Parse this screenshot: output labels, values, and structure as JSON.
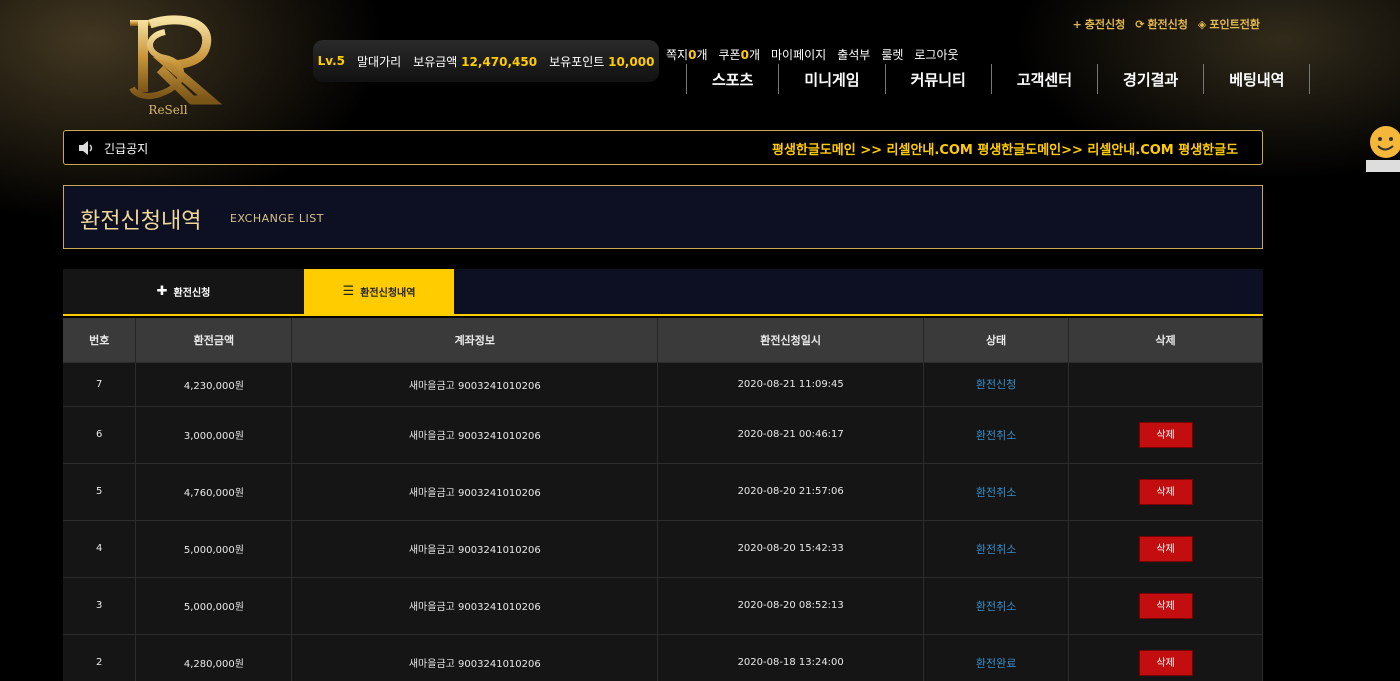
{
  "logo": {
    "text": "ReSell",
    "brand_color": "#d9b870"
  },
  "userbar": {
    "level": "Lv.5",
    "nickname": "말대가리",
    "balance_label": "보유금액",
    "balance_value": "12,470,450",
    "points_label": "보유포인트",
    "points_value": "10,000"
  },
  "toplinks": {
    "note_label": "쪽지",
    "note_count": "0",
    "note_unit": "개",
    "coupon_label": "쿠폰",
    "coupon_count": "0",
    "coupon_unit": "개",
    "mypage": "마이페이지",
    "attendance": "출석부",
    "roulette": "룰렛",
    "logout": "로그아웃"
  },
  "util": {
    "charge": "충전신청",
    "exchange": "환전신청",
    "points": "포인트전환"
  },
  "nav": [
    "스포츠",
    "미니게임",
    "커뮤니티",
    "고객센터",
    "경기결과",
    "베팅내역"
  ],
  "notice": {
    "label": "긴급공지",
    "marquee": "평생한글도메인 >> 리셀안내.COM 평생한글도메인>> 리셀안내.COM 평생한글도"
  },
  "page": {
    "title": "환전신청내역",
    "subtitle": "EXCHANGE LIST"
  },
  "tabs": {
    "request": "환전신청",
    "history": "환전신청내역"
  },
  "table": {
    "headers": [
      "번호",
      "환전금액",
      "계좌정보",
      "환전신청일시",
      "상태",
      "삭제"
    ],
    "delete_label": "삭제",
    "rows": [
      {
        "no": "7",
        "amount": "4,230,000원",
        "account": "새마을금고 9003241010206",
        "date": "2020-08-21 11:09:45",
        "status": "환전신청",
        "deletable": false
      },
      {
        "no": "6",
        "amount": "3,000,000원",
        "account": "새마을금고 9003241010206",
        "date": "2020-08-21 00:46:17",
        "status": "환전취소",
        "deletable": true
      },
      {
        "no": "5",
        "amount": "4,760,000원",
        "account": "새마을금고 9003241010206",
        "date": "2020-08-20 21:57:06",
        "status": "환전취소",
        "deletable": true
      },
      {
        "no": "4",
        "amount": "5,000,000원",
        "account": "새마을금고 9003241010206",
        "date": "2020-08-20 15:42:33",
        "status": "환전취소",
        "deletable": true
      },
      {
        "no": "3",
        "amount": "5,000,000원",
        "account": "새마을금고 9003241010206",
        "date": "2020-08-20 08:52:13",
        "status": "환전취소",
        "deletable": true
      },
      {
        "no": "2",
        "amount": "4,280,000원",
        "account": "새마을금고 9003241010206",
        "date": "2020-08-18 13:24:00",
        "status": "환전완료",
        "deletable": true
      }
    ]
  },
  "colors": {
    "accent": "#ffcc00",
    "gold_border": "#c9a94f",
    "status_blue": "#3b8dc8",
    "delete_red": "#c20e0e",
    "title_bg": "#0c1022"
  }
}
